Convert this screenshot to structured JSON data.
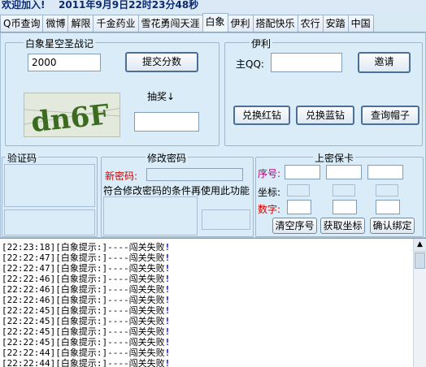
{
  "title": {
    "prefix": "欢迎加入!",
    "datetime": "2011年9月9日22时23分48秒"
  },
  "tabs": [
    "Q币查询",
    "微博",
    "解限",
    "千金药业",
    "雪花勇闯天涯",
    "白象",
    "伊利",
    "搭配快乐",
    "农行",
    "安踏",
    "中国"
  ],
  "active_tab": "白象",
  "baixiang": {
    "group_title": "白象星空圣战记",
    "value_input": "2000",
    "submit_label": "提交分数",
    "captcha_text": "dn6F",
    "lottery_label": "抽奖↓",
    "lottery_input": ""
  },
  "yili": {
    "group_title": "伊利",
    "qq_label": "主QQ:",
    "qq_input": "",
    "invite_label": "邀请",
    "red_label": "兑换红钻",
    "blue_label": "兑换蓝钻",
    "hat_label": "查询帽子"
  },
  "verify": {
    "group_title": "验证码"
  },
  "password": {
    "group_title": "修改密码",
    "new_pwd_label": "新密码:",
    "new_pwd_value": "",
    "hint": "符合修改密码的条件再使用此功能"
  },
  "security": {
    "group_title": "上密保卡",
    "serial_label": "序号:",
    "coord_label": "坐标:",
    "digit_label": "数字:",
    "clear_label": "清空序号",
    "fetch_label": "获取坐标",
    "confirm_label": "确认绑定"
  },
  "log_lines": [
    {
      "time": "[22:23:18]",
      "msg": "[白象提示:]----闯关失败",
      "mark": "!"
    },
    {
      "time": "[22:22:47]",
      "msg": "[白象提示:]----闯关失败",
      "mark": "!"
    },
    {
      "time": "[22:22:47]",
      "msg": "[白象提示:]----闯关失败",
      "mark": "!"
    },
    {
      "time": "[22:22:46]",
      "msg": "[白象提示:]----闯关失败",
      "mark": "!"
    },
    {
      "time": "[22:22:46]",
      "msg": "[白象提示:]----闯关失败",
      "mark": "!"
    },
    {
      "time": "[22:22:46]",
      "msg": "[白象提示:]----闯关失败",
      "mark": "!"
    },
    {
      "time": "[22:22:45]",
      "msg": "[白象提示:]----闯关失败",
      "mark": "!"
    },
    {
      "time": "[22:22:45]",
      "msg": "[白象提示:]----闯关失败",
      "mark": "!"
    },
    {
      "time": "[22:22:45]",
      "msg": "[白象提示:]----闯关失败",
      "mark": "!"
    },
    {
      "time": "[22:22:45]",
      "msg": "[白象提示:]----闯关失败",
      "mark": "!"
    },
    {
      "time": "[22:22:44]",
      "msg": "[白象提示:]----闯关失败",
      "mark": "!"
    },
    {
      "time": "[22:22:44]",
      "msg": "[白象提示:]----闯关失败",
      "mark": "!"
    }
  ],
  "colors": {
    "red_label": "#cc0000",
    "magenta_label": "#b0007a",
    "title_text": "#0a2a6e"
  }
}
